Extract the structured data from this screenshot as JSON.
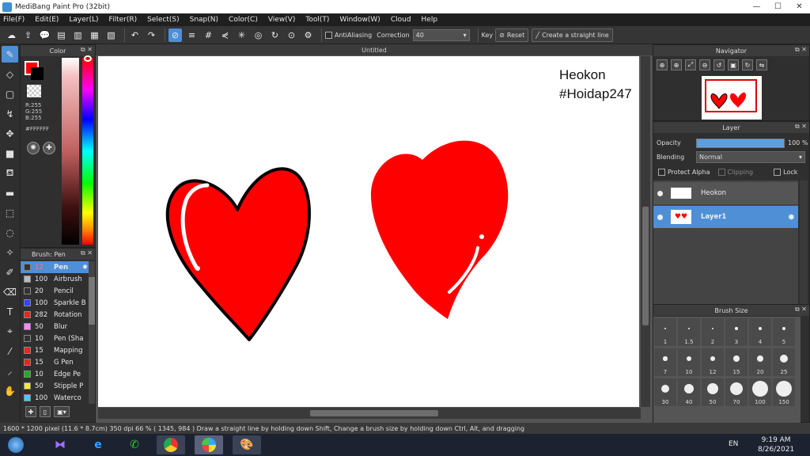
{
  "window": {
    "title": "MediBang Paint Pro (32bit)",
    "min": "—",
    "max": "☐",
    "close": "✕"
  },
  "menu": [
    "File(F)",
    "Edit(E)",
    "Layer(L)",
    "Filter(R)",
    "Select(S)",
    "Snap(N)",
    "Color(C)",
    "View(V)",
    "Tool(T)",
    "Window(W)",
    "Cloud",
    "Help"
  ],
  "toolbar": {
    "antialiasing_label": "AntiAliasing",
    "correction_label": "Correction",
    "correction_value": "40",
    "key_label": "Key",
    "reset_label": "Reset",
    "straight_line_label": "Create a straight line"
  },
  "color_panel": {
    "title": "Color",
    "r": "R:255",
    "g": "G:255",
    "b": "B:255",
    "hex": "#FFFFFF",
    "fg_color": "#ff0000",
    "bg_color": "#000000"
  },
  "brush_panel": {
    "title": "Brush: Pen",
    "items": [
      {
        "size": "12",
        "name": "Pen",
        "color": "#333333"
      },
      {
        "size": "100",
        "name": "Airbrush",
        "color": "#bbbbbb"
      },
      {
        "size": "20",
        "name": "Pencil",
        "color": "#333333"
      },
      {
        "size": "100",
        "name": "Sparkle B",
        "color": "#3344ff"
      },
      {
        "size": "282",
        "name": "Rotation",
        "color": "#ee2222"
      },
      {
        "size": "50",
        "name": "Blur",
        "color": "#ff88ff"
      },
      {
        "size": "10",
        "name": "Pen (Sha",
        "color": "#333333"
      },
      {
        "size": "15",
        "name": "Mapping",
        "color": "#ee2222"
      },
      {
        "size": "15",
        "name": "G Pen",
        "color": "#ee2222"
      },
      {
        "size": "10",
        "name": "Edge Pe",
        "color": "#22aa22"
      },
      {
        "size": "50",
        "name": "Stipple P",
        "color": "#eeee22"
      },
      {
        "size": "100",
        "name": "Waterco",
        "color": "#44ccff"
      }
    ]
  },
  "document": {
    "tab_title": "Untitled",
    "canvas_text_1": "Heokon",
    "canvas_text_2": "#Hoidap247"
  },
  "navigator": {
    "title": "Navigator"
  },
  "layer_panel": {
    "title": "Layer",
    "opacity_label": "Opacity",
    "opacity_value": "100 %",
    "blending_label": "Blending",
    "blending_value": "Normal",
    "protect_alpha": "Protect Alpha",
    "clipping": "Clipping",
    "lock": "Lock",
    "layers": [
      {
        "name": "Heokon"
      },
      {
        "name": "Layer1"
      }
    ]
  },
  "brush_size_panel": {
    "title": "Brush Size",
    "sizes": [
      "1",
      "1.5",
      "2",
      "3",
      "4",
      "5",
      "7",
      "10",
      "12",
      "15",
      "20",
      "25",
      "30",
      "40",
      "50",
      "70",
      "100",
      "150"
    ]
  },
  "status": {
    "text": "1600 * 1200 pixel   (11.6 * 8.7cm)   350 dpi   66 %   ( 1345, 984 )   Draw a straight line by holding down Shift, Change a brush size by holding down Ctrl, Alt, and dragging"
  },
  "taskbar": {
    "lang": "EN",
    "time": "9:19 AM",
    "date": "8/26/2021"
  }
}
